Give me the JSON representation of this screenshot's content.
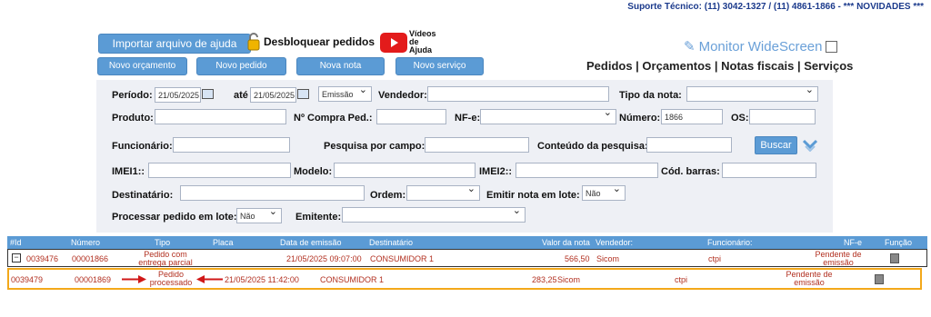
{
  "header": {
    "support_text": "Suporte Técnico: (11) 3042-1327 / (11) 4861-1866 - *** NOVIDADES ***"
  },
  "toolbar": {
    "import_label": "Importar arquivo de ajuda",
    "unlock_label": "Desbloquear pedidos",
    "videos_label": "Vídeos de Ajuda",
    "youtube_label": "YouTube",
    "monitor_label": "Monitor WideScreen",
    "new_buttons": [
      "Novo orçamento",
      "Novo pedido",
      "Nova nota",
      "Novo serviço"
    ],
    "nav_links": "Pedidos | Orçamentos | Notas fiscais | Serviços"
  },
  "filters": {
    "periodo_label": "Período:",
    "periodo_from": "21/05/2025",
    "ate_label": "até",
    "periodo_to": "21/05/2025",
    "date_type": "Emissão",
    "vendedor_label": "Vendedor:",
    "tipo_nota_label": "Tipo da nota:",
    "produto_label": "Produto:",
    "compra_label": "Nº Compra Ped.:",
    "nfe_label": "NF-e:",
    "numero_label": "Número:",
    "numero_value": "1866",
    "os_label": "OS:",
    "funcionario_label": "Funcionário:",
    "pesquisa_label": "Pesquisa por campo:",
    "conteudo_label": "Conteúdo da pesquisa:",
    "buscar_label": "Buscar",
    "imei1_label": "IMEI1::",
    "modelo_label": "Modelo:",
    "imei2_label": "IMEI2::",
    "barras_label": "Cód. barras:",
    "destinatario_label": "Destinatário:",
    "ordem_label": "Ordem:",
    "emitir_label": "Emitir nota em lote:",
    "emitir_value": "Não",
    "processar_label": "Processar pedido em lote:",
    "processar_value": "Não",
    "emitente_label": "Emitente:"
  },
  "table": {
    "headers": [
      "#Id",
      "Número",
      "Tipo",
      "Placa",
      "Data de emissão",
      "Destinatário",
      "Valor da nota",
      "Vendedor:",
      "Funcionário:",
      "NF-e",
      "Função"
    ],
    "rows": [
      {
        "id": "0039476",
        "numero": "00001866",
        "tipo": "Pedido com entrega parcial",
        "data": "21/05/2025 09:07:00",
        "destinatario": "CONSUMIDOR 1",
        "valor": "566,50",
        "vendedor": "Sicom",
        "funcionario": "ctpi",
        "nfe": "Pendente de emissão"
      },
      {
        "id": "0039479",
        "numero": "00001869",
        "tipo": "Pedido processado",
        "data": "21/05/2025 11:42:00",
        "destinatario": "CONSUMIDOR 1",
        "valor": "283,25",
        "vendedor": "Sicom",
        "funcionario": "ctpi",
        "nfe": "Pendente de emissão"
      }
    ]
  },
  "colors": {
    "accent": "#5b9bd5",
    "row_text": "#b23020",
    "highlight": "#f3a81a",
    "arrow": "#d01818"
  }
}
